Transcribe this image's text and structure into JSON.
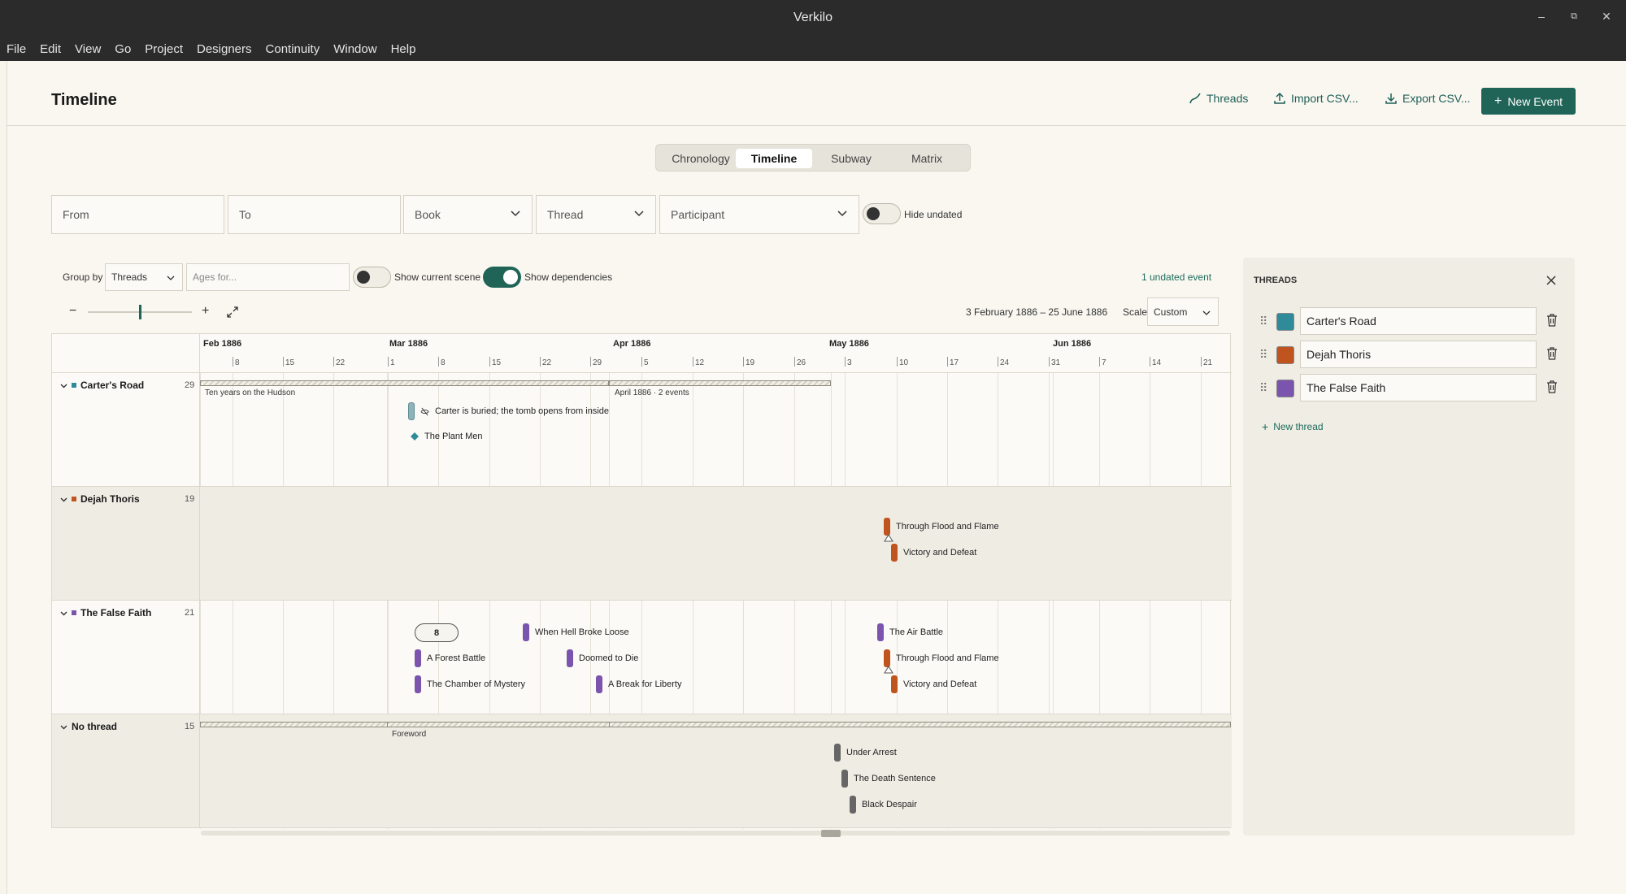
{
  "window": {
    "title": "Verkilo",
    "minimize": "–",
    "restore": "⧉",
    "close": "✕"
  },
  "menu": [
    "File",
    "Edit",
    "View",
    "Go",
    "Project",
    "Designers",
    "Continuity",
    "Window",
    "Help"
  ],
  "header": {
    "title": "Timeline",
    "threads_btn": "Threads",
    "import_btn": "Import CSV...",
    "export_btn": "Export CSV...",
    "new_event_btn": "New Event"
  },
  "tabs": [
    "Chronology",
    "Timeline",
    "Subway",
    "Matrix"
  ],
  "active_tab": "Timeline",
  "filters": {
    "from": "From",
    "to": "To",
    "book": "Book",
    "thread": "Thread",
    "participant": "Participant",
    "hide_undated": "Hide undated"
  },
  "controls": {
    "group_by_label": "Group by",
    "group_by_value": "Threads",
    "ages_placeholder": "Ages for...",
    "show_current_scene": "Show current scene",
    "show_dependencies": "Show dependencies",
    "undated_link": "1 undated event",
    "zoom_level": 0.5,
    "date_range": "3 February 1886 – 25 June 1886",
    "scale_label": "Scale",
    "scale_value": "Custom"
  },
  "axis": {
    "months": [
      "Feb 1886",
      "Mar 1886",
      "Apr 1886",
      "May 1886",
      "Jun 1886"
    ],
    "ticks": [
      "8",
      "15",
      "22",
      "1",
      "8",
      "15",
      "22",
      "29",
      "5",
      "12",
      "19",
      "26",
      "3",
      "10",
      "17",
      "24",
      "31",
      "7",
      "14",
      "21"
    ]
  },
  "lanes": [
    {
      "name": "Carter's Road",
      "count": "29",
      "color": "#2f8a9a",
      "spans": [
        {
          "label": "Ten years on the Hudson"
        },
        {
          "label": "April 1886 · 2 events"
        }
      ],
      "events": [
        {
          "label": "Carter is buried; the tomb opens from inside",
          "icon": "eye-off-icon"
        },
        {
          "label": "The Plant Men",
          "icon": "diamond-icon"
        }
      ]
    },
    {
      "name": "Dejah Thoris",
      "count": "19",
      "color": "#c0541e",
      "events": [
        {
          "label": "Through Flood and Flame"
        },
        {
          "label": "Victory and Defeat"
        }
      ]
    },
    {
      "name": "The False Faith",
      "count": "21",
      "color": "#7b55ad",
      "cluster": "8",
      "events": [
        {
          "label": "When Hell Broke Loose"
        },
        {
          "label": "A Forest Battle"
        },
        {
          "label": "Doomed to Die"
        },
        {
          "label": "The Chamber of Mystery"
        },
        {
          "label": "A Break for Liberty"
        },
        {
          "label": "The Air Battle"
        },
        {
          "label": "Through Flood and Flame"
        },
        {
          "label": "Victory and Defeat"
        }
      ]
    },
    {
      "name": "No thread",
      "count": "15",
      "color": "#666666",
      "spans": [
        {
          "label": "Foreword"
        }
      ],
      "events": [
        {
          "label": "Under Arrest"
        },
        {
          "label": "The Death Sentence"
        },
        {
          "label": "Black Despair"
        }
      ]
    }
  ],
  "threads_panel": {
    "title": "THREADS",
    "items": [
      {
        "name": "Carter's Road",
        "color": "#2f8a9a"
      },
      {
        "name": "Dejah Thoris",
        "color": "#c0541e"
      },
      {
        "name": "The False Faith",
        "color": "#7b55ad"
      }
    ],
    "new_thread": "New thread"
  }
}
